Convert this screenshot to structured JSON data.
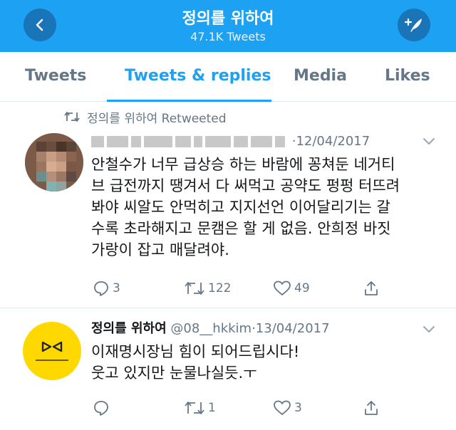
{
  "header": {
    "title": "정의를 위하여",
    "subtitle": "47.1K Tweets"
  },
  "tabs": [
    {
      "label": "Tweets",
      "active": false
    },
    {
      "label": "Tweets & replies",
      "active": true
    },
    {
      "label": "Media",
      "active": false
    },
    {
      "label": "Likes",
      "active": false
    }
  ],
  "tweets": [
    {
      "retweet_label": "정의를 위하여 Retweeted",
      "author_name_hidden": true,
      "date": "·12/04/2017",
      "lines": [
        "안철수가 너무 급상승 하는 바람에 꽁쳐둔 네거티",
        "브 급전까지 땡겨서 다 써먹고 공약도 펑펑 터뜨려",
        "봐야 씨알도 안먹히고 지지선언 이어달리기는 갈",
        "수록 초라해지고 문캠은 할 게 없음. 안희정 바짓",
        "가랑이 잡고 매달려야."
      ],
      "replies": "3",
      "retweets": "122",
      "likes": "49"
    },
    {
      "author_name": "정의를 위하여",
      "handle": "@08__hkkim",
      "date": "·13/04/2017",
      "lines": [
        "이재명시장님 힘이 되어드립시다!",
        "웃고 있지만 눈물나실듯.ㅜ"
      ],
      "replies": "",
      "retweets": "1",
      "likes": "3"
    }
  ],
  "colors": {
    "brand": "#1da1f2",
    "header_button": "#1a74b8",
    "muted": "#657786",
    "avatar_yellow": "#ffd800"
  },
  "icons": [
    "back-arrow-icon",
    "compose-tweet-icon",
    "retweet-icon",
    "chevron-down-icon",
    "reply-icon",
    "heart-icon",
    "share-icon"
  ]
}
